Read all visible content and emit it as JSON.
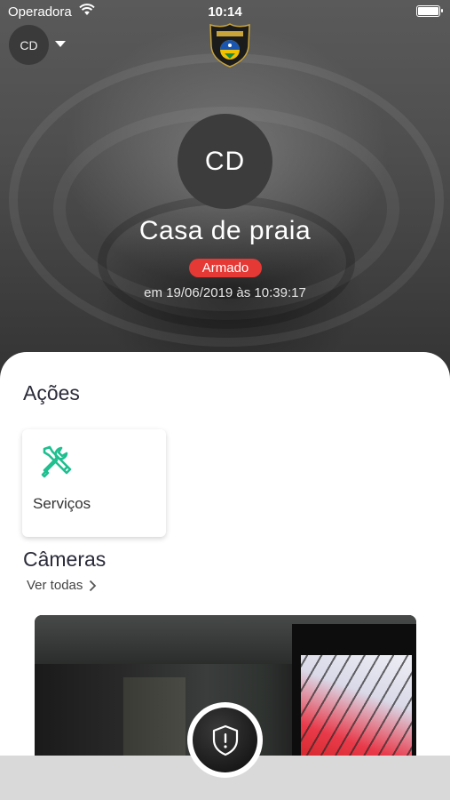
{
  "status_bar": {
    "carrier": "Operadora",
    "time": "10:14"
  },
  "header": {
    "account_initials": "CD"
  },
  "property": {
    "avatar_initials": "CD",
    "name": "Casa de praia",
    "state": "Armado",
    "state_color": "#e53935",
    "timestamp": "em 19/06/2019 às 10:39:17"
  },
  "actions": {
    "title": "Ações",
    "items": [
      {
        "label": "Serviços",
        "icon": "tools-icon",
        "icon_color": "#1fbf8f"
      }
    ]
  },
  "cameras": {
    "title": "Câmeras",
    "see_all": "Ver todas"
  },
  "fab": {
    "icon": "shield-alert-icon"
  }
}
